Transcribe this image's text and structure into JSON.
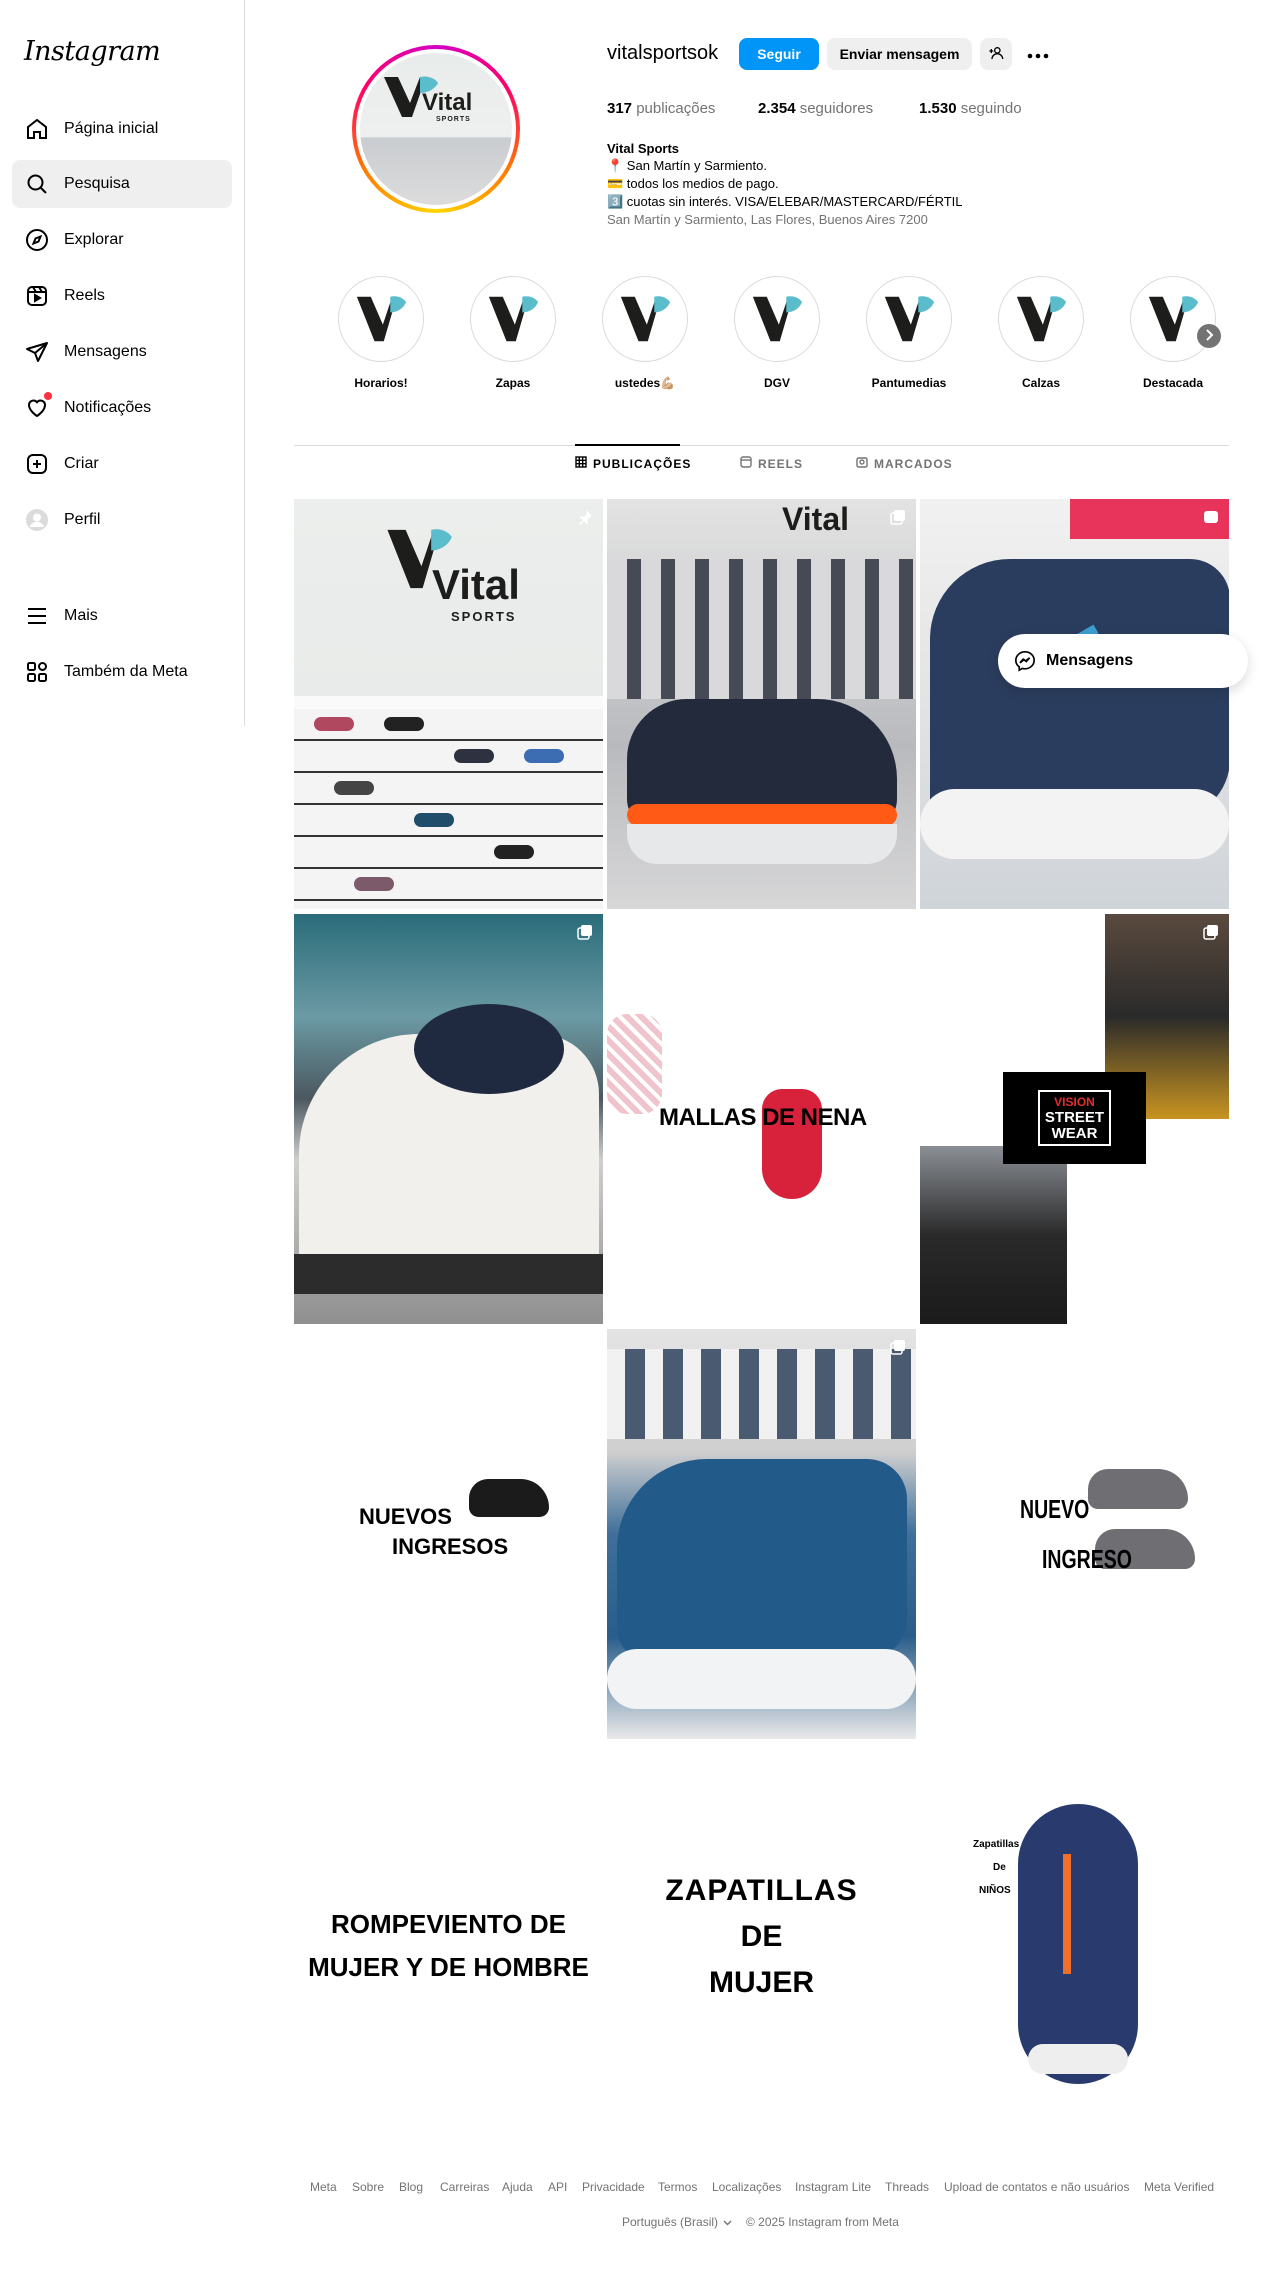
{
  "app": {
    "logo_text": "Instagram"
  },
  "sidebar": {
    "items": [
      {
        "label": "Página inicial",
        "icon": "home-icon"
      },
      {
        "label": "Pesquisa",
        "icon": "search-icon"
      },
      {
        "label": "Explorar",
        "icon": "compass-icon"
      },
      {
        "label": "Reels",
        "icon": "reels-icon"
      },
      {
        "label": "Mensagens",
        "icon": "paper-plane-icon"
      },
      {
        "label": "Notificações",
        "icon": "heart-icon"
      },
      {
        "label": "Criar",
        "icon": "plus-square-icon"
      },
      {
        "label": "Perfil",
        "icon": "profile-avatar-icon"
      }
    ],
    "more": {
      "label": "Mais",
      "icon": "hamburger-icon"
    },
    "meta": {
      "label": "Também da Meta",
      "icon": "meta-apps-icon"
    }
  },
  "profile": {
    "username": "vitalsportsok",
    "follow_label": "Seguir",
    "message_label": "Enviar mensagem",
    "stats": {
      "posts_count": "317",
      "posts_label": "publicações",
      "followers_count": "2.354",
      "followers_label": "seguidores",
      "following_count": "1.530",
      "following_label": "seguindo"
    },
    "bio": {
      "name": "Vital Sports",
      "line1": "📍 San Martín y Sarmiento.",
      "line2": "💳 todos los medios de pago.",
      "line3": "3️⃣ cuotas sin interés. VISA/ELEBAR/MASTERCARD/FÉRTIL",
      "location": "San Martín y Sarmiento, Las Flores, Buenos Aires 7200"
    },
    "avatar_text": {
      "brand": "Vital",
      "sub": "SPORTS"
    }
  },
  "highlights": [
    "Horarios!",
    "Zapas",
    "ustedes💪🏼",
    "DGV",
    "Pantumedias",
    "Calzas",
    "Destacada"
  ],
  "tabs": {
    "posts": "PUBLICAÇÕES",
    "reels": "REELS",
    "tagged": "MARCADOS"
  },
  "posts": {
    "p1_brand": "Vital",
    "p1_sub": "SPORTS",
    "p2_brand": "Vital",
    "p5_text": "MALLAS DE NENA",
    "p6_logo": [
      "VISION",
      "STREET",
      "WEAR"
    ],
    "p7_text": [
      "NUEVOS",
      "INGRESOS"
    ],
    "p9_text": [
      "NUEVO",
      "INGRESO"
    ],
    "p10_text": [
      "ROMPEVIENTO DE",
      "MUJER Y DE HOMBRE"
    ],
    "p11_text": [
      "ZAPATILLAS",
      "DE",
      "MUJER"
    ],
    "p12_text": [
      "Zapatillas",
      "De",
      "NIÑOS"
    ]
  },
  "floating_messages": {
    "label": "Mensagens"
  },
  "footer": {
    "links": [
      "Meta",
      "Sobre",
      "Blog",
      "Carreiras",
      "Ajuda",
      "API",
      "Privacidade",
      "Termos",
      "Localizações",
      "Instagram Lite",
      "Threads",
      "Upload de contatos e não usuários",
      "Meta Verified"
    ],
    "language": "Português (Brasil)",
    "copyright": "© 2025 Instagram from Meta"
  },
  "colors": {
    "accent": "#0095f6",
    "secondary_button": "#efefef",
    "muted_text": "#737373",
    "notification_dot": "#ff3040",
    "brand_teal": "#5bbccb"
  }
}
